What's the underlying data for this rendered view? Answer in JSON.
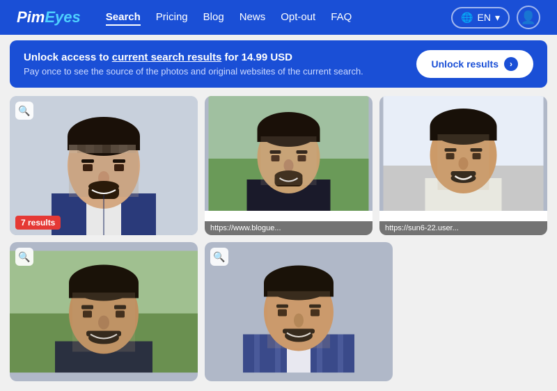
{
  "header": {
    "logo": "PimEyes",
    "nav_items": [
      {
        "label": "Search",
        "active": true
      },
      {
        "label": "Pricing",
        "active": false
      },
      {
        "label": "Blog",
        "active": false
      },
      {
        "label": "News",
        "active": false
      },
      {
        "label": "Opt-out",
        "active": false
      },
      {
        "label": "FAQ",
        "active": false
      }
    ],
    "lang_label": "EN",
    "lang_icon": "🌐"
  },
  "banner": {
    "heading_prefix": "Unlock access to ",
    "heading_link": "current search results",
    "heading_suffix": " for 14.99 USD",
    "subtext": "Pay once to see the source of the photos and original websites of the current search.",
    "unlock_button": "Unlock results"
  },
  "results": [
    {
      "id": 1,
      "size": "large",
      "badge": "7 results",
      "url": null,
      "has_icon": true
    },
    {
      "id": 2,
      "size": "medium",
      "badge": null,
      "url": "https://www.blogue...",
      "has_icon": false
    },
    {
      "id": 3,
      "size": "medium",
      "badge": null,
      "url": "https://sun6-22.user...",
      "has_icon": false
    },
    {
      "id": 4,
      "size": "bottom",
      "badge": null,
      "url": null,
      "has_icon": true
    },
    {
      "id": 5,
      "size": "bottom",
      "badge": null,
      "url": null,
      "has_icon": true
    }
  ],
  "colors": {
    "primary": "#1a4fd6",
    "badge_red": "#e53935",
    "white": "#ffffff"
  }
}
